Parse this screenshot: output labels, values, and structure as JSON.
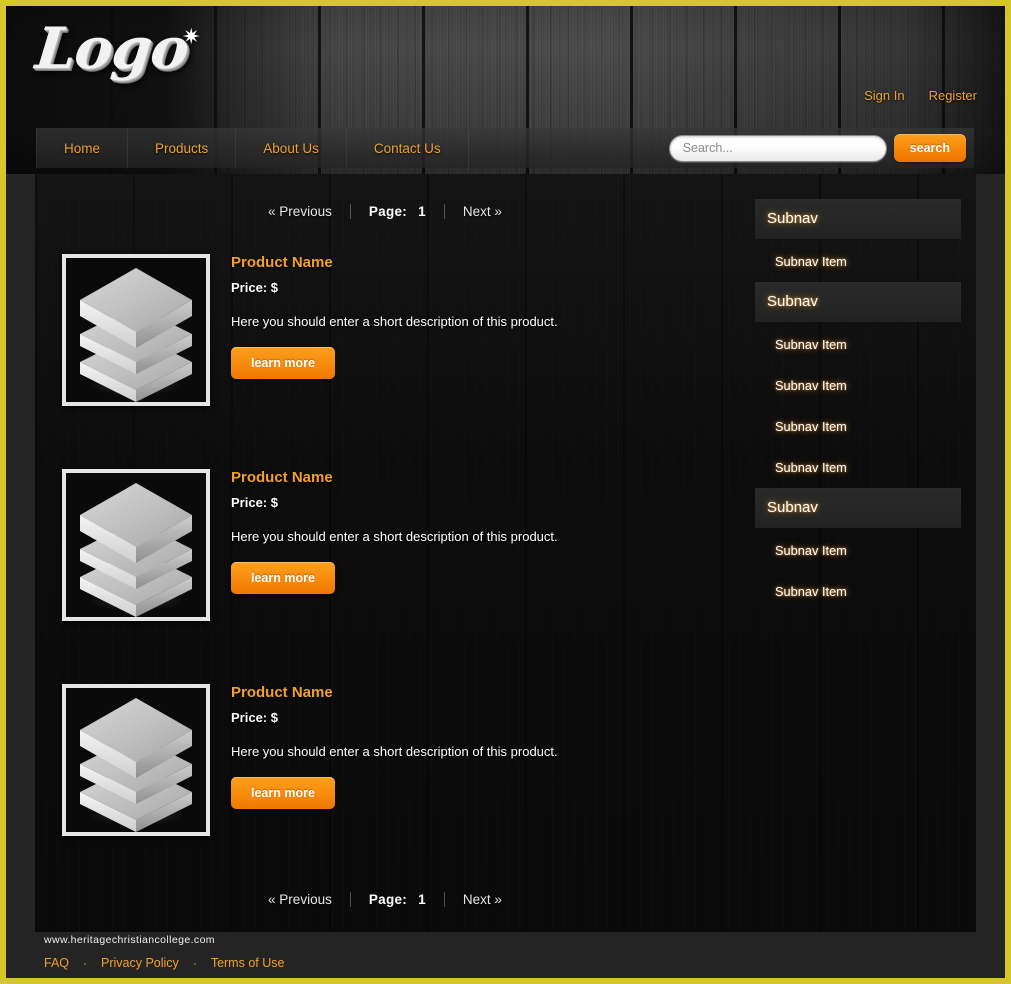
{
  "brand": {
    "logo_text": "Logo",
    "logo_star": "✷",
    "accent_orange": "#f0a030",
    "border_yellow": "#d6c62e",
    "panel_bg": "#0c0c0c"
  },
  "account": {
    "sign_in": "Sign In",
    "register": "Register"
  },
  "nav": {
    "items": [
      {
        "label": "Home"
      },
      {
        "label": "Products"
      },
      {
        "label": "About Us"
      },
      {
        "label": "Contact Us"
      }
    ]
  },
  "search": {
    "placeholder": "Search...",
    "value": "",
    "button_label": "search"
  },
  "pagination": {
    "previous_label": "« Previous",
    "page_label": "Page:",
    "page_number": "1",
    "next_label": "Next »"
  },
  "products": [
    {
      "title": "Product Name",
      "price": "Price: $",
      "description": "Here you should enter a short description of this product.",
      "button_label": "learn more",
      "image_alt": "stacked-layers-icon"
    },
    {
      "title": "Product Name",
      "price": "Price: $",
      "description": "Here you should enter a short description of this product.",
      "button_label": "learn more",
      "image_alt": "stacked-layers-icon"
    },
    {
      "title": "Product Name",
      "price": "Price: $",
      "description": "Here you should enter a short description of this product.",
      "button_label": "learn more",
      "image_alt": "stacked-layers-icon"
    }
  ],
  "subnav": {
    "groups": [
      {
        "header": "Subnav",
        "items": [
          "Subnav Item"
        ]
      },
      {
        "header": "Subnav",
        "items": [
          "Subnav Item",
          "Subnav Item",
          "Subnav Item",
          "Subnav Item"
        ]
      },
      {
        "header": "Subnav",
        "items": [
          "Subnav Item",
          "Subnav Item"
        ]
      }
    ]
  },
  "footer": {
    "site": "www.heritagechristiancollege.com",
    "links": [
      {
        "label": "FAQ"
      },
      {
        "label": "Privacy Policy"
      },
      {
        "label": "Terms of Use"
      }
    ],
    "separator": "·"
  }
}
